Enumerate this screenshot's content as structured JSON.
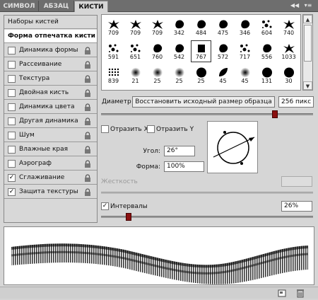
{
  "tabs": [
    {
      "label": "СИМВОЛ",
      "active": false
    },
    {
      "label": "АБЗАЦ",
      "active": false
    },
    {
      "label": "КИСТИ",
      "active": true
    }
  ],
  "window_controls": {
    "collapse": "◀◀",
    "menu": "▾≡"
  },
  "left_list": [
    {
      "label": "Наборы кистей",
      "checkbox": false,
      "lock": false,
      "checked": false,
      "selected": false
    },
    {
      "label": "Форма отпечатка кисти",
      "checkbox": false,
      "lock": false,
      "checked": false,
      "selected": true
    },
    {
      "label": "Динамика формы",
      "checkbox": true,
      "lock": true,
      "checked": false,
      "selected": false
    },
    {
      "label": "Рассеивание",
      "checkbox": true,
      "lock": true,
      "checked": false,
      "selected": false
    },
    {
      "label": "Текстура",
      "checkbox": true,
      "lock": true,
      "checked": false,
      "selected": false
    },
    {
      "label": "Двойная кисть",
      "checkbox": true,
      "lock": true,
      "checked": false,
      "selected": false
    },
    {
      "label": "Динамика цвета",
      "checkbox": true,
      "lock": true,
      "checked": false,
      "selected": false
    },
    {
      "label": "Другая динамика",
      "checkbox": true,
      "lock": true,
      "checked": false,
      "selected": false
    },
    {
      "label": "Шум",
      "checkbox": true,
      "lock": true,
      "checked": false,
      "selected": false
    },
    {
      "label": "Влажные края",
      "checkbox": true,
      "lock": true,
      "checked": false,
      "selected": false
    },
    {
      "label": "Аэрограф",
      "checkbox": true,
      "lock": true,
      "checked": false,
      "selected": false
    },
    {
      "label": "Сглаживание",
      "checkbox": true,
      "lock": true,
      "checked": true,
      "selected": false
    },
    {
      "label": "Защита текстуры",
      "checkbox": true,
      "lock": true,
      "checked": true,
      "selected": false
    }
  ],
  "brushes": [
    {
      "size": "709",
      "icon": "splatter-brush"
    },
    {
      "size": "709",
      "icon": "splatter-brush"
    },
    {
      "size": "709",
      "icon": "splatter-brush"
    },
    {
      "size": "342",
      "icon": "blob-brush"
    },
    {
      "size": "484",
      "icon": "blob-brush"
    },
    {
      "size": "475",
      "icon": "blob-brush"
    },
    {
      "size": "346",
      "icon": "blob-brush"
    },
    {
      "size": "604",
      "icon": "scatter-brush"
    },
    {
      "size": "740",
      "icon": "splatter-brush"
    },
    {
      "size": "591",
      "icon": "scatter-brush"
    },
    {
      "size": "651",
      "icon": "scatter-brush"
    },
    {
      "size": "760",
      "icon": "blob-brush"
    },
    {
      "size": "542",
      "icon": "blob-brush"
    },
    {
      "size": "767",
      "icon": "square-brush"
    },
    {
      "size": "572",
      "icon": "blob-brush"
    },
    {
      "size": "717",
      "icon": "scatter-brush"
    },
    {
      "size": "556",
      "icon": "blob-brush"
    },
    {
      "size": "1033",
      "icon": "splatter-brush"
    },
    {
      "size": "839",
      "icon": "dots-brush"
    },
    {
      "size": "21",
      "icon": "soft-round-brush"
    },
    {
      "size": "25",
      "icon": "soft-round-brush"
    },
    {
      "size": "25",
      "icon": "soft-round-brush"
    },
    {
      "size": "25",
      "icon": "hard-round-brush"
    },
    {
      "size": "45",
      "icon": "leaf-brush"
    },
    {
      "size": "45",
      "icon": "soft-round-brush"
    },
    {
      "size": "131",
      "icon": "hard-round-brush"
    },
    {
      "size": "30",
      "icon": "hard-round-brush"
    }
  ],
  "selected_brush_index": 13,
  "diameter": {
    "label": "Диаметр",
    "reset_button": "Восстановить исходный размер образца",
    "value": "256 пикс",
    "slider_fraction": 0.83
  },
  "flip": {
    "x_label": "Отразить X",
    "y_label": "Отразить Y",
    "x_checked": false,
    "y_checked": false
  },
  "angle": {
    "label": "Угол:",
    "value": "26°"
  },
  "roundness": {
    "label": "Форма:",
    "value": "100%"
  },
  "hardness": {
    "label": "Жесткость",
    "enabled": false
  },
  "spacing": {
    "label": "Интервалы",
    "checked": true,
    "value": "26%",
    "slider_fraction": 0.12
  },
  "colors": {
    "tabbar": "#6e6e6e",
    "panel": "#d6d6d6",
    "handle": "#8a1010"
  }
}
